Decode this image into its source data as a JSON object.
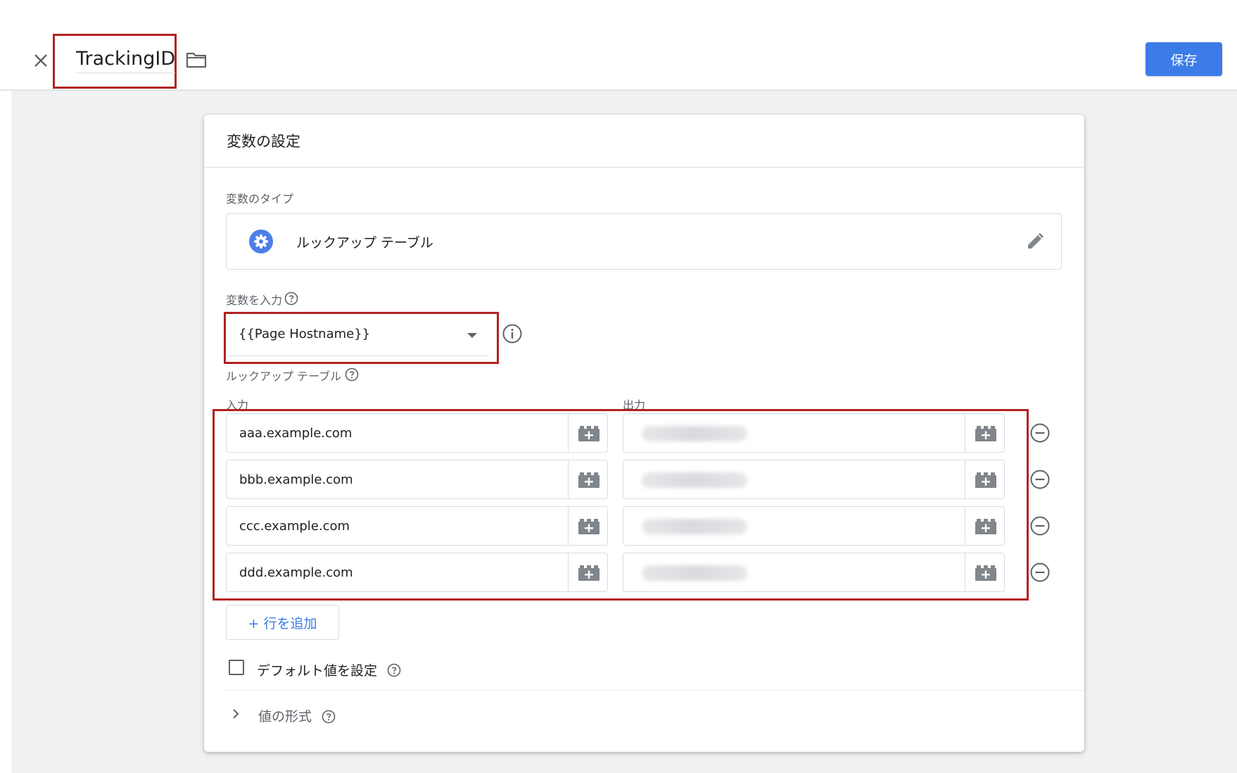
{
  "header": {
    "title": "TrackingID",
    "save_label": "保存"
  },
  "card": {
    "title": "変数の設定",
    "variable_type_label": "変数のタイプ",
    "variable_type_value": "ルックアップ テーブル",
    "input_variable_label": "変数を入力",
    "input_variable_value": "{{Page Hostname}}",
    "lookup_table_label": "ルックアップ テーブル",
    "input_col": "入力",
    "output_col": "出力",
    "rows": [
      {
        "input": "aaa.example.com",
        "output": ""
      },
      {
        "input": "bbb.example.com",
        "output": ""
      },
      {
        "input": "ccc.example.com",
        "output": ""
      },
      {
        "input": "ddd.example.com",
        "output": ""
      }
    ],
    "add_row_label": "+ 行を追加",
    "default_value_label": "デフォルト値を設定",
    "format_label": "値の形式"
  },
  "colors": {
    "accent": "#3b7ce8",
    "highlight": "#b22222"
  }
}
